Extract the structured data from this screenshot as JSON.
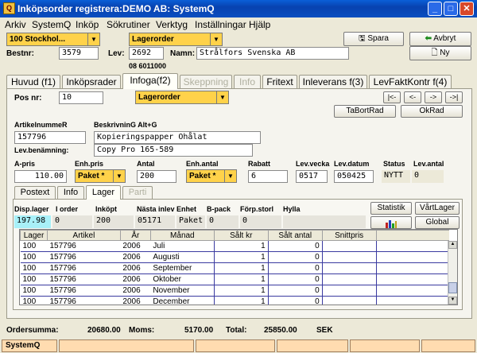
{
  "window": {
    "title": "Inköpsorder registrera:DEMO AB: SystemQ",
    "min": "_",
    "max": "□",
    "close": "✕"
  },
  "menu": [
    "Arkiv",
    "SystemQ",
    "Inköp",
    "Sökrutiner",
    "Verktyg",
    "Inställningar",
    "Hjälp"
  ],
  "header": {
    "company": "100   Stockhol...",
    "order_type": "Lagerorder",
    "save_label": "Spara",
    "cancel_label": "Avbryt",
    "new_label": "Ny",
    "bestnr_label": "Bestnr:",
    "bestnr": "3579",
    "lev_label": "Lev:",
    "lev": "2692",
    "namn_label": "Namn:",
    "namn": "Strålfors Svenska AB",
    "phone": "08 6011000"
  },
  "tabs": [
    "Huvud (f1)",
    "Inköpsrader",
    "Infoga(f2)",
    "Skeppning",
    "Info",
    "Fritext",
    "Inleverans f(3)",
    "LevFaktKontr f(4)"
  ],
  "row": {
    "posnr_label": "Pos nr:",
    "posnr": "10",
    "row_type": "Lagerorder",
    "nav": [
      "|<-",
      "<-",
      "->",
      "->|"
    ],
    "delete_label": "TaBortRad",
    "ok_label": "OkRad",
    "artnr_label": "ArtikelnummeR",
    "artnr": "157796",
    "beskr_label": "BeskrivninG Alt+G",
    "beskr": "Kopieringspapper Ohålat",
    "levben_label": "Lev.benämning:",
    "levben": "Copy Pro 165-589",
    "apris_label": "A-pris",
    "apris": "110.00",
    "enhpris_label": "Enh.pris",
    "enhpris": "Paket *",
    "antal_label": "Antal",
    "antal": "200",
    "enhantal_label": "Enh.antal",
    "enhantal": "Paket *",
    "rabatt_label": "Rabatt",
    "rabatt": "6",
    "levvecka_label": "Lev.vecka",
    "levvecka": "0517",
    "levdatum_label": "Lev.datum",
    "levdatum": "050425",
    "status_label": "Status",
    "status": "NYTT",
    "levantal_label": "Lev.antal",
    "levantal": "0"
  },
  "subtabs": [
    "Postext",
    "Info",
    "Lager",
    "Parti"
  ],
  "stock": {
    "headers": [
      "Disp.lager",
      "I order",
      "Inköpt",
      "Nästa inlev",
      "Enhet",
      "B-pack",
      "Förp.storl",
      "Hylla"
    ],
    "values": [
      "197.98",
      "0",
      "200",
      "05171",
      "Paket",
      "0",
      "0",
      ""
    ],
    "statistik_label": "Statistik",
    "vartlager_label": "VårtLager",
    "global_label": "Global"
  },
  "grid": {
    "columns": [
      "Lager",
      "Artikel",
      "År",
      "Månad",
      "Sålt kr",
      "Sålt antal",
      "Snittpris"
    ],
    "rows": [
      [
        "100",
        "157796",
        "2006",
        "Juli",
        "1",
        "0",
        ""
      ],
      [
        "100",
        "157796",
        "2006",
        "Augusti",
        "1",
        "0",
        ""
      ],
      [
        "100",
        "157796",
        "2006",
        "September",
        "1",
        "0",
        ""
      ],
      [
        "100",
        "157796",
        "2006",
        "Oktober",
        "1",
        "0",
        ""
      ],
      [
        "100",
        "157796",
        "2006",
        "November",
        "1",
        "0",
        ""
      ],
      [
        "100",
        "157796",
        "2006",
        "December",
        "1",
        "0",
        ""
      ]
    ]
  },
  "summary": {
    "ordersumma_label": "Ordersumma:",
    "ordersumma": "20680.00",
    "moms_label": "Moms:",
    "moms": "5170.00",
    "total_label": "Total:",
    "total": "25850.00",
    "currency": "SEK"
  },
  "statusbar": {
    "app": "SystemQ"
  }
}
